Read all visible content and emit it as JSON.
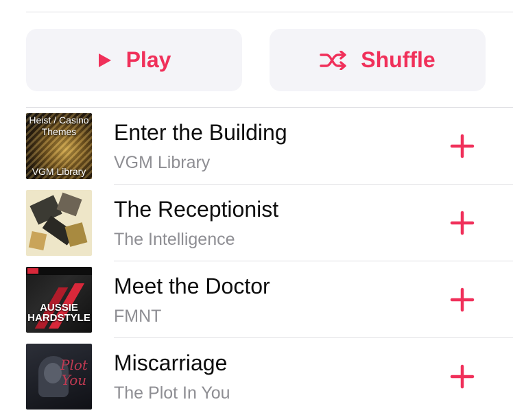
{
  "actions": {
    "play_label": "Play",
    "shuffle_label": "Shuffle"
  },
  "songs": [
    {
      "title": "Enter the Building",
      "artist": "VGM Library",
      "art_text_top": "Heist / Casino Themes",
      "art_text_bottom": "VGM Library"
    },
    {
      "title": "The Receptionist",
      "artist": "The Intelligence"
    },
    {
      "title": "Meet the Doctor",
      "artist": "FMNT",
      "art_text_center": "AUSSIE HARDSTYLE"
    },
    {
      "title": "Miscarriage",
      "artist": "The Plot In You",
      "art_text_script": "Plot You"
    }
  ],
  "colors": {
    "accent": "#f0305a",
    "button_bg": "#f4f4f8",
    "secondary_text": "#8e8e93",
    "divider": "#dedee2"
  },
  "icons": {
    "play": "play-icon",
    "shuffle": "shuffle-icon",
    "add": "plus-icon"
  }
}
